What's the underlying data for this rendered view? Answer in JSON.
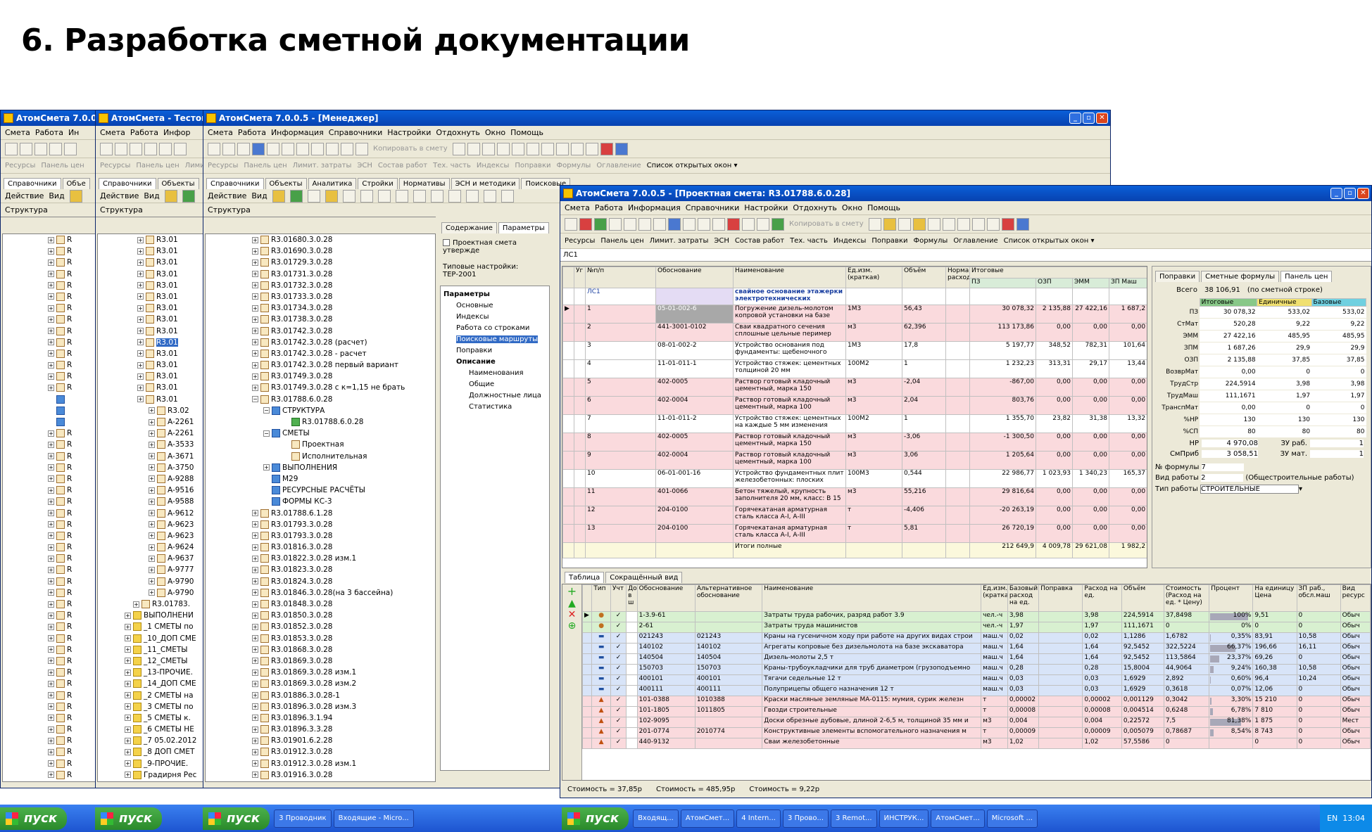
{
  "slide_title": "6. Разработка сметной документации",
  "win1": {
    "title": "АтомСмета  7.0.0",
    "menu": [
      "Смета",
      "Работа",
      "Ин"
    ],
    "tabs": [
      "Справочники",
      "Объе"
    ],
    "actions": [
      "Действие",
      "Вид"
    ],
    "panel": "Структура",
    "links": [
      "Ресурсы",
      "Панель цен"
    ]
  },
  "win2": {
    "title": "АтомСмета - Тестова",
    "menu": [
      "Смета",
      "Работа",
      "Инфор"
    ],
    "tabs": [
      "Справочники",
      "Объекты"
    ],
    "actions": [
      "Действие",
      "Вид"
    ],
    "panel": "Структура",
    "links": [
      "Ресурсы",
      "Панель цен",
      "Лими"
    ]
  },
  "win3": {
    "title": "АтомСмета  7.0.0.5   - [Менеджер]",
    "menu": [
      "Смета",
      "Работа",
      "Информация",
      "Справочники",
      "Настройки",
      "Отдохнуть",
      "Окно",
      "Помощь"
    ],
    "copy_label": "Копировать в смету",
    "links": [
      "Ресурсы",
      "Панель цен",
      "Лимит. затраты",
      "ЭСН",
      "Состав работ",
      "Тех. часть",
      "Индексы",
      "Поправки",
      "Формулы",
      "Оглавление"
    ],
    "open_windows": "Список открытых окон",
    "tabs": [
      "Справочники",
      "Объекты",
      "Аналитика",
      "Стройки",
      "Нормативы",
      "ЭСН и методики",
      "Поисковые"
    ],
    "actions": [
      "Действие",
      "Вид"
    ],
    "panel": "Структура",
    "right_tabs": [
      "Содержание",
      "Параметры"
    ],
    "approved": "Проектная смета утвержде",
    "typical_label": "Типовые настройки:",
    "typical_value": "ТЕР-2001",
    "params": [
      {
        "t": "Параметры",
        "b": true,
        "l": 0
      },
      {
        "t": "Основные",
        "l": 1
      },
      {
        "t": "Индексы",
        "l": 1
      },
      {
        "t": "Работа со строками",
        "l": 1
      },
      {
        "t": "Поисковые маршруты",
        "l": 1,
        "sel": true
      },
      {
        "t": "Поправки",
        "l": 1
      },
      {
        "t": "Описание",
        "b": true,
        "l": 1
      },
      {
        "t": "Наименования",
        "l": 2
      },
      {
        "t": "Общие",
        "l": 2
      },
      {
        "t": "Должностные лица",
        "l": 2
      },
      {
        "t": "Статистика",
        "l": 2
      }
    ]
  },
  "tree1": [
    "R",
    "R",
    "R",
    "R",
    "R",
    "R",
    "R",
    "R",
    "R",
    "R",
    "R",
    "R",
    "R",
    "R",
    "",
    "",
    "",
    "R",
    "R",
    "R",
    "R",
    "R",
    "R",
    "R",
    "R",
    "R",
    "R",
    "R",
    "R",
    "R",
    "R",
    "R",
    "R",
    "R",
    "R",
    "R",
    "R",
    "R",
    "R",
    "R",
    "R",
    "R",
    "R",
    "R",
    "R",
    "R",
    "R",
    "R",
    "R"
  ],
  "tree2": [
    "R3.01",
    "R3.01",
    "R3.01",
    "R3.01",
    "R3.01",
    "R3.01",
    "R3.01",
    "R3.01",
    "R3.01",
    "R3.01",
    "R3.01",
    "R3.01",
    "R3.01",
    "R3.01",
    "R3.01",
    "R3.02",
    "A-2261",
    "A-2261",
    "A-3533",
    "A-3671",
    "A-3750",
    "A-9288",
    "A-9516",
    "A-9588",
    "A-9612",
    "A-9623",
    "A-9623",
    "A-9624",
    "A-9637",
    "A-9777",
    "A-9790",
    "A-9790",
    "R3.01783.",
    "ВЫПОЛНЕНИ",
    "_1 СМЕТЫ по",
    "_10_ДОП СМЕ",
    "_11_СМЕТЫ",
    "_12_СМЕТЫ",
    "_13-ПРОЧИЕ.",
    "_14_ДОП СМЕ",
    "_2 СМЕТЫ на",
    "_3 СМЕТЫ  по",
    "_5 СМЕТЫ к.",
    "_6 СМЕТЫ НЕ",
    "_7 05.02.2012",
    "_8 ДОП СМЕТ",
    "_9-ПРОЧИЕ.",
    "Градирня Рес"
  ],
  "tree3": [
    "R3.01680.3.0.28",
    "R3.01690.3.0.28",
    "R3.01729.3.0.28",
    "R3.01731.3.0.28",
    "R3.01732.3.0.28",
    "R3.01733.3.0.28",
    "R3.01734.3.0.28",
    "R3.01738.3.0.28",
    "R3.01742.3.0.28",
    "R3.01742.3.0.28 (расчет)",
    "R3.01742.3.0.28 - расчет",
    "R3.01742.3.0.28 первый вариант",
    "R3.01749.3.0.28",
    "R3.01749.3.0.28 с к=1,15 не брать",
    "R3.01788.6.0.28",
    "СТРУКТУРА",
    "R3.01788.6.0.28",
    "СМЕТЫ",
    "Проектная",
    "Исполнительная",
    "ВЫПОЛНЕНИЯ",
    "М29",
    "РЕСУРСНЫЕ РАСЧЁТЫ",
    "ФОРМЫ КС-3",
    "R3.01788.6.1.28",
    "R3.01793.3.0.28",
    "R3.01793.3.0.28",
    "R3.01816.3.0.28",
    "R3.01822.3.0.28 изм.1",
    "R3.01823.3.0.28",
    "R3.01824.3.0.28",
    "R3.01846.3.0.28(на 3 бассейна)",
    "R3.01848.3.0.28",
    "R3.01850.3.0.28",
    "R3.01852.3.0.28",
    "R3.01853.3.0.28",
    "R3.01868.3.0.28",
    "R3.01869.3.0.28",
    "R3.01869.3.0.28 изм.1",
    "R3.01869.3.0.28 изм.2",
    "R3.01886.3.0.28-1",
    "R3.01896.3.0.28 изм.3",
    "R3.01896.3.1.94",
    "R3.01896.3.3.28",
    "R3.01901.6.2.28",
    "R3.01912.3.0.28",
    "R3.01912.3.0.28 изм.1",
    "R3.01916.3.0.28"
  ],
  "win4": {
    "title": "АтомСмета  7.0.0.5   - [Проектная смета: R3.01788.6.0.28]",
    "menu": [
      "Смета",
      "Работа",
      "Информация",
      "Справочники",
      "Настройки",
      "Отдохнуть",
      "Окно",
      "Помощь"
    ],
    "copy_label": "Копировать в смету",
    "links": [
      "Ресурсы",
      "Панель цен",
      "Лимит. затраты",
      "ЭСН",
      "Состав работ",
      "Тех. часть",
      "Индексы",
      "Поправки",
      "Формулы",
      "Оглавление"
    ],
    "open_windows": "Список открытых окон",
    "path": "ЛС1",
    "grid_headers": [
      "Уг",
      "№п/п",
      "Обоснование",
      "Наименование",
      "Ед.изм. (краткая)",
      "Объём",
      "Норма расход",
      "Итоговые"
    ],
    "sub_headers": [
      "ПЗ",
      "ОЗП",
      "ЭММ",
      "ЗП Маш"
    ],
    "section": {
      "code": "ЛС1",
      "name": "свайное основание этажерки электротехнических"
    },
    "rows": [
      {
        "n": "1",
        "code": "05-01-002-6",
        "name": "Погружение дизель-молотом копровой установки на базе",
        "u": "1М3",
        "v": "56,43",
        "pz": "30 078,32",
        "ozp": "2 135,88",
        "emm": "27 422,16",
        "zpm": "1 687,2",
        "c": "pink"
      },
      {
        "n": "2",
        "code": "441-3001-0102",
        "name": "Сваи квадратного сечения сплошные цельные пеример",
        "u": "м3",
        "v": "62,396",
        "pz": "113 173,86",
        "ozp": "0,00",
        "emm": "0,00",
        "zpm": "0,00",
        "c": "pink"
      },
      {
        "n": "3",
        "code": "08-01-002-2",
        "name": "Устройство основания под фундаменты: щебеночного",
        "u": "1М3",
        "v": "17,8",
        "pz": "5 197,77",
        "ozp": "348,52",
        "emm": "782,31",
        "zpm": "101,64",
        "c": "wt"
      },
      {
        "n": "4",
        "code": "11-01-011-1",
        "name": "Устройство стяжек: цементных толщиной 20 мм",
        "u": "100М2",
        "v": "1",
        "pz": "1 232,23",
        "ozp": "313,31",
        "emm": "29,17",
        "zpm": "13,44",
        "c": "wt"
      },
      {
        "n": "5",
        "code": "402-0005",
        "name": "Раствор готовый кладочный цементный, марка 150",
        "u": "м3",
        "v": "-2,04",
        "pz": "-867,00",
        "ozp": "0,00",
        "emm": "0,00",
        "zpm": "0,00",
        "c": "pink"
      },
      {
        "n": "6",
        "code": "402-0004",
        "name": "Раствор готовый кладочный цементный, марка 100",
        "u": "м3",
        "v": "2,04",
        "pz": "803,76",
        "ozp": "0,00",
        "emm": "0,00",
        "zpm": "0,00",
        "c": "pink"
      },
      {
        "n": "7",
        "code": "11-01-011-2",
        "name": "Устройство стяжек: цементных на каждые 5 мм изменения",
        "u": "100М2",
        "v": "1",
        "pz": "1 355,70",
        "ozp": "23,82",
        "emm": "31,38",
        "zpm": "13,32",
        "c": "wt"
      },
      {
        "n": "8",
        "code": "402-0005",
        "name": "Раствор готовый кладочный цементный, марка 150",
        "u": "м3",
        "v": "-3,06",
        "pz": "-1 300,50",
        "ozp": "0,00",
        "emm": "0,00",
        "zpm": "0,00",
        "c": "pink"
      },
      {
        "n": "9",
        "code": "402-0004",
        "name": "Раствор готовый кладочный цементный, марка 100",
        "u": "м3",
        "v": "3,06",
        "pz": "1 205,64",
        "ozp": "0,00",
        "emm": "0,00",
        "zpm": "0,00",
        "c": "pink"
      },
      {
        "n": "10",
        "code": "06-01-001-16",
        "name": "Устройство фундаментных плит железобетонных: плоских",
        "u": "100М3",
        "v": "0,544",
        "pz": "22 986,77",
        "ozp": "1 023,93",
        "emm": "1 340,23",
        "zpm": "165,37",
        "c": "wt"
      },
      {
        "n": "11",
        "code": "401-0066",
        "name": "Бетон тяжелый, крупность заполнителя 20 мм, класс: В 15",
        "u": "м3",
        "v": "55,216",
        "pz": "29 816,64",
        "ozp": "0,00",
        "emm": "0,00",
        "zpm": "0,00",
        "c": "pink"
      },
      {
        "n": "12",
        "code": "204-0100",
        "name": "Горячекатаная арматурная сталь класса А-I, А-III",
        "u": "т",
        "v": "-4,406",
        "pz": "-20 263,19",
        "ozp": "0,00",
        "emm": "0,00",
        "zpm": "0,00",
        "c": "pink"
      },
      {
        "n": "13",
        "code": "204-0100",
        "name": "Горячекатаная арматурная сталь класса А-I, А-III",
        "u": "т",
        "v": "5,81",
        "pz": "26 720,19",
        "ozp": "0,00",
        "emm": "0,00",
        "zpm": "0,00",
        "c": "pink"
      }
    ],
    "total": {
      "name": "Итоги полные",
      "pz": "212 649,9",
      "ozp": "4 009,78",
      "emm": "29 621,08",
      "zpm": "1 982,2"
    },
    "bottom_tabs": [
      "Таблица",
      "Сокращённый вид"
    ],
    "side": {
      "tabs": [
        "Поправки",
        "Сметные формулы",
        "Панель цен"
      ],
      "total_label": "Всего",
      "total_value": "38 106,91",
      "total_note": "(по сметной строке)",
      "cols": [
        "Итоговые",
        "Единичные",
        "Базовые"
      ],
      "rows": [
        [
          "ПЗ",
          "30 078,32",
          "533,02",
          "533,02"
        ],
        [
          "СтМат",
          "520,28",
          "9,22",
          "9,22"
        ],
        [
          "ЭММ",
          "27 422,16",
          "485,95",
          "485,95"
        ],
        [
          "ЗПМ",
          "1 687,26",
          "29,9",
          "29,9"
        ],
        [
          "ОЗП",
          "2 135,88",
          "37,85",
          "37,85"
        ],
        [
          "ВозврМат",
          "0,00",
          "0",
          "0"
        ],
        [
          "ТрудСтр",
          "224,5914",
          "3,98",
          "3,98"
        ],
        [
          "ТрудМаш",
          "111,1671",
          "1,97",
          "1,97"
        ],
        [
          "ТранспМат",
          "0,00",
          "0",
          "0"
        ],
        [
          "%НР",
          "130",
          "130",
          "130"
        ],
        [
          "%СП",
          "80",
          "80",
          "80"
        ]
      ],
      "nr_label": "НР",
      "nr_value": "4 970,08",
      "zu_rab": "ЗУ раб.",
      "zu_rab_v": "1",
      "sp_label": "СмПриб",
      "sp_value": "3 058,51",
      "zu_mat": "ЗУ мат.",
      "zu_mat_v": "1",
      "formula_label": "№ формулы",
      "formula_value": "7",
      "worktype_label": "Вид работы",
      "worktype_value": "2",
      "worktype_note": "(Общестроительные работы)",
      "type_label": "Тип работы",
      "type_value": "СТРОИТЕЛЬНЫЕ"
    },
    "res_headers": [
      "Тип",
      "Учт",
      "Доп в ш",
      "Обоснование",
      "Альтернативное обоснование",
      "Наименование",
      "Ед.изм. (кратка)",
      "Базовый расход на ед.",
      "Поправка",
      "Расход на ед.",
      "Объём",
      "Стоимость (Расход на ед. * Цену)",
      "Процент",
      "На единицу Цена",
      "ЗП раб., обсл.маш",
      "Вид ресурс"
    ],
    "res_rows": [
      {
        "code": "1-3.9-61",
        "alt": "",
        "name": "Затраты труда рабочих, разряд работ 3.9",
        "u": "чел.-ч",
        "base": "3,98",
        "corr": "",
        "rate": "3,98",
        "vol": "224,5914",
        "cost": "37,8498",
        "pct": "100%",
        "price": "9,51",
        "zp": "0",
        "kind": "Обыч",
        "c": "gr"
      },
      {
        "code": "2-61",
        "alt": "",
        "name": "Затраты труда машинистов",
        "u": "чел.-ч",
        "base": "1,97",
        "corr": "",
        "rate": "1,97",
        "vol": "111,1671",
        "cost": "0",
        "pct": "0%",
        "price": "0",
        "zp": "0",
        "kind": "Обыч",
        "c": "gr"
      },
      {
        "code": "021243",
        "alt": "021243",
        "name": "Краны на гусеничном ходу при работе на других видах строи",
        "u": "маш.ч",
        "base": "0,02",
        "corr": "",
        "rate": "0,02",
        "vol": "1,1286",
        "cost": "1,6782",
        "pct": "0,35%",
        "price": "83,91",
        "zp": "10,58",
        "kind": "Обыч",
        "c": "bl"
      },
      {
        "code": "140102",
        "alt": "140102",
        "name": "Агрегаты копровые без дизельмолота на базе экскаватора",
        "u": "маш.ч",
        "base": "1,64",
        "corr": "",
        "rate": "1,64",
        "vol": "92,5452",
        "cost": "322,5224",
        "pct": "66,37%",
        "price": "196,66",
        "zp": "16,11",
        "kind": "Обыч",
        "c": "bl"
      },
      {
        "code": "140504",
        "alt": "140504",
        "name": "Дизель-молоты 2,5 т",
        "u": "маш.ч",
        "base": "1,64",
        "corr": "",
        "rate": "1,64",
        "vol": "92,5452",
        "cost": "113,5864",
        "pct": "23,37%",
        "price": "69,26",
        "zp": "0",
        "kind": "Обыч",
        "c": "bl"
      },
      {
        "code": "150703",
        "alt": "150703",
        "name": "Краны-трубоукладчики для труб диаметром (грузоподъемно",
        "u": "маш.ч",
        "base": "0,28",
        "corr": "",
        "rate": "0,28",
        "vol": "15,8004",
        "cost": "44,9064",
        "pct": "9,24%",
        "price": "160,38",
        "zp": "10,58",
        "kind": "Обыч",
        "c": "bl"
      },
      {
        "code": "400101",
        "alt": "400101",
        "name": "Тягачи седельные 12 т",
        "u": "маш.ч",
        "base": "0,03",
        "corr": "",
        "rate": "0,03",
        "vol": "1,6929",
        "cost": "2,892",
        "pct": "0,60%",
        "price": "96,4",
        "zp": "10,24",
        "kind": "Обыч",
        "c": "bl"
      },
      {
        "code": "400111",
        "alt": "400111",
        "name": "Полуприцепы общего назначения 12 т",
        "u": "маш.ч",
        "base": "0,03",
        "corr": "",
        "rate": "0,03",
        "vol": "1,6929",
        "cost": "0,3618",
        "pct": "0,07%",
        "price": "12,06",
        "zp": "0",
        "kind": "Обыч",
        "c": "bl"
      },
      {
        "code": "101-0388",
        "alt": "1010388",
        "name": "Краски масляные земляные МА-0115: мумия, сурик железн",
        "u": "т",
        "base": "0,00002",
        "corr": "",
        "rate": "0,00002",
        "vol": "0,001129",
        "cost": "0,3042",
        "pct": "3,30%",
        "price": "15 210",
        "zp": "0",
        "kind": "Обыч",
        "c": "pink"
      },
      {
        "code": "101-1805",
        "alt": "1011805",
        "name": "Гвозди строительные",
        "u": "т",
        "base": "0,00008",
        "corr": "",
        "rate": "0,00008",
        "vol": "0,004514",
        "cost": "0,6248",
        "pct": "6,78%",
        "price": "7 810",
        "zp": "0",
        "kind": "Обыч",
        "c": "pink"
      },
      {
        "code": "102-9095",
        "alt": "",
        "name": "Доски обрезные дубовые, длиной 2-6,5 м, толщиной 35 мм и",
        "u": "м3",
        "base": "0,004",
        "corr": "",
        "rate": "0,004",
        "vol": "0,22572",
        "cost": "7,5",
        "pct": "81,38%",
        "price": "1 875",
        "zp": "0",
        "kind": "Мест",
        "c": "pink"
      },
      {
        "code": "201-0774",
        "alt": "2010774",
        "name": "Конструктивные элементы вспомогательного назначения м",
        "u": "т",
        "base": "0,00009",
        "corr": "",
        "rate": "0,00009",
        "vol": "0,005079",
        "cost": "0,78687",
        "pct": "8,54%",
        "price": "8 743",
        "zp": "0",
        "kind": "Обыч",
        "c": "pink"
      },
      {
        "code": "440-9132",
        "alt": "",
        "name": "Сваи железобетонные",
        "u": "м3",
        "base": "1,02",
        "corr": "",
        "rate": "1,02",
        "vol": "57,5586",
        "cost": "0",
        "pct": "",
        "price": "0",
        "zp": "0",
        "kind": "Обыч",
        "c": "pink"
      }
    ],
    "status": [
      "Стоимость = 37,85р",
      "Стоимость = 485,95р",
      "Стоимость = 9,22р"
    ]
  },
  "taskbar": {
    "start": "пуск",
    "items": [
      "3 Проводник",
      "Входящие - Micro...",
      "Входящ...",
      "АтомСмет...",
      "4 Intern...",
      "3 Прово...",
      "3 Remot...",
      "ИНСТРУК...",
      "АтомСмет...",
      "Microsoft ..."
    ],
    "lang": "EN",
    "clock": "13:04"
  },
  "pct_fill": [
    100,
    0,
    0.35,
    66.37,
    23.37,
    9.24,
    0.6,
    0.07,
    3.3,
    6.78,
    81.38,
    8.54,
    0
  ]
}
